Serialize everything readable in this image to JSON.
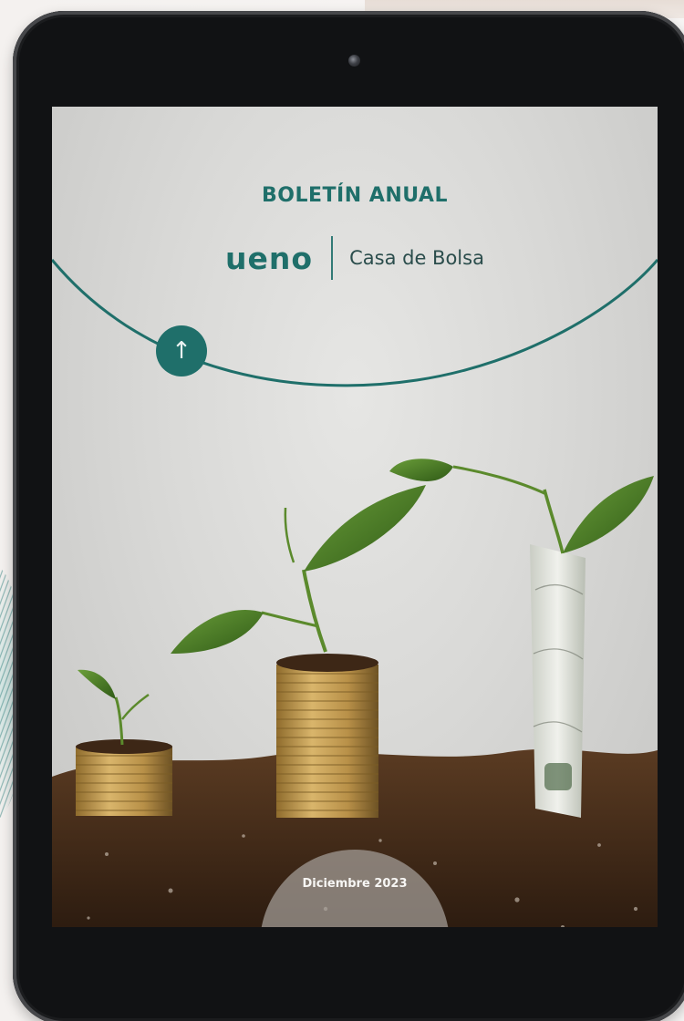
{
  "cover": {
    "title": "BOLETÍN ANUAL",
    "brand_name": "ueno",
    "brand_subtitle": "Casa de Bolsa",
    "date": "Diciembre 2023"
  },
  "icons": {
    "arrow": "arrow-up-icon"
  },
  "colors": {
    "brand_teal": "#1f6f6a",
    "device_black": "#111214"
  }
}
